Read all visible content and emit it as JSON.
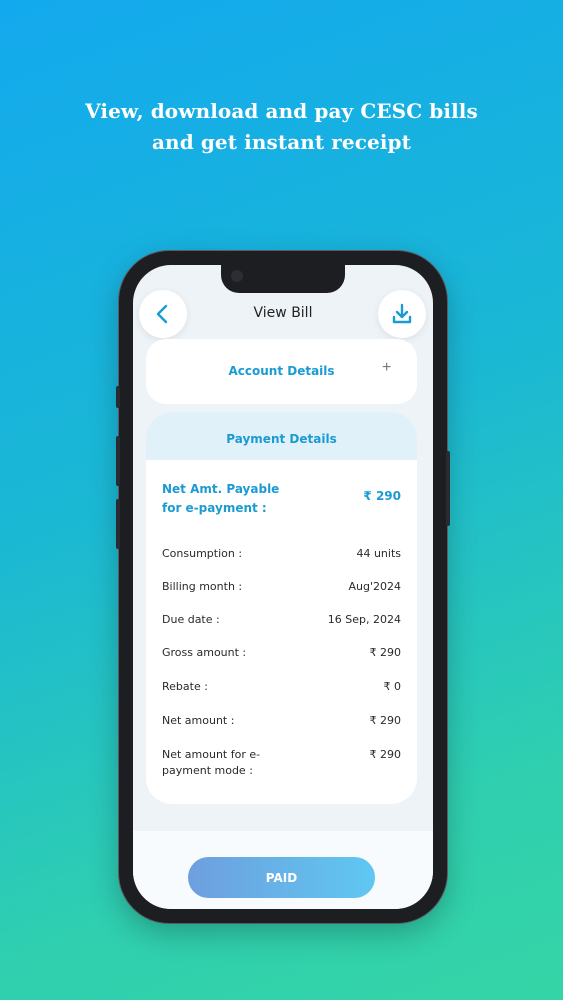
{
  "headline": {
    "line1": "View, download and pay CESC bills",
    "line2": "and get instant receipt"
  },
  "header": {
    "title": "View Bill",
    "back_icon": "chevron-left-icon",
    "download_icon": "download-icon"
  },
  "account_details": {
    "title": "Account Details",
    "expand_symbol": "+"
  },
  "payment_details": {
    "title": "Payment Details",
    "net_payable_label": "Net Amt. Payable for e-payment :",
    "net_payable_value": "₹ 290",
    "rows": [
      {
        "label": "Consumption :",
        "value": "44 units"
      },
      {
        "label": "Billing month :",
        "value": "Aug'2024"
      },
      {
        "label": "Due date :",
        "value": "16 Sep, 2024"
      },
      {
        "label": "Gross amount :",
        "value": "₹ 290"
      },
      {
        "label": "Rebate :",
        "value": "₹ 0"
      },
      {
        "label": "Net amount :",
        "value": "₹ 290"
      },
      {
        "label": "Net amount for e-payment mode :",
        "value": "₹ 290"
      }
    ]
  },
  "footer": {
    "status_button": "PAID"
  },
  "colors": {
    "accent": "#1a9bd2",
    "background_start": "#13a9ee",
    "background_end": "#35d4a6"
  }
}
